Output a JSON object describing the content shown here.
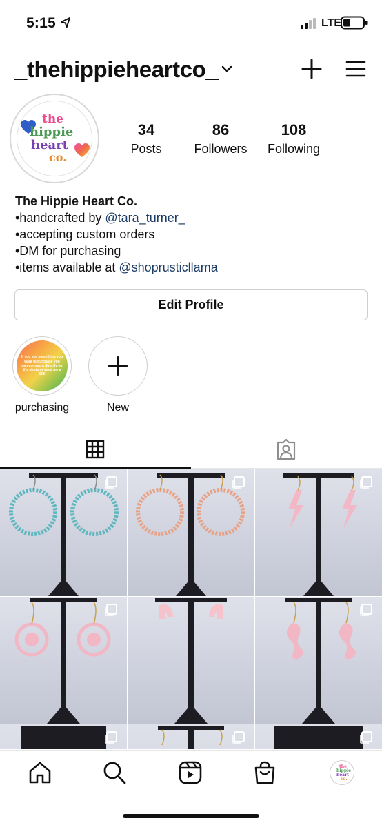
{
  "status_bar": {
    "time": "5:15",
    "network": "LTE"
  },
  "header": {
    "username": "_thehippieheartco_"
  },
  "profile": {
    "avatar_text": [
      "the",
      "hippie",
      "heart",
      "co."
    ],
    "stats": [
      {
        "number": "34",
        "label": "Posts"
      },
      {
        "number": "86",
        "label": "Followers"
      },
      {
        "number": "108",
        "label": "Following"
      }
    ],
    "bio": {
      "name": "The Hippie Heart Co.",
      "line1_prefix": "•handcrafted by ",
      "line1_mention": "@tara_turner_",
      "line2": "•accepting custom orders",
      "line3": "•DM for purchasing",
      "line4_prefix": "•items available at ",
      "line4_mention": "@shoprusticllama"
    },
    "edit_profile_label": "Edit Profile"
  },
  "highlights": [
    {
      "label": "purchasing",
      "cover_text": "If you see something you want to purchase you can comment directly on the photo or send me a DM!"
    },
    {
      "label": "New"
    }
  ],
  "grid": {
    "posts": [
      {
        "subject": "teal bead hoop earrings"
      },
      {
        "subject": "peach bead hoop earrings"
      },
      {
        "subject": "pink lightning bolt earrings"
      },
      {
        "subject": "pink circle earrings"
      },
      {
        "subject": "pink hoop earrings"
      },
      {
        "subject": "pink snake earrings"
      },
      {
        "subject": "earrings on card"
      },
      {
        "subject": "earrings"
      },
      {
        "subject": "earrings on card"
      }
    ]
  },
  "colors": {
    "mention": "#1d3d66",
    "text": "#111111",
    "border": "#cfcfcf"
  }
}
